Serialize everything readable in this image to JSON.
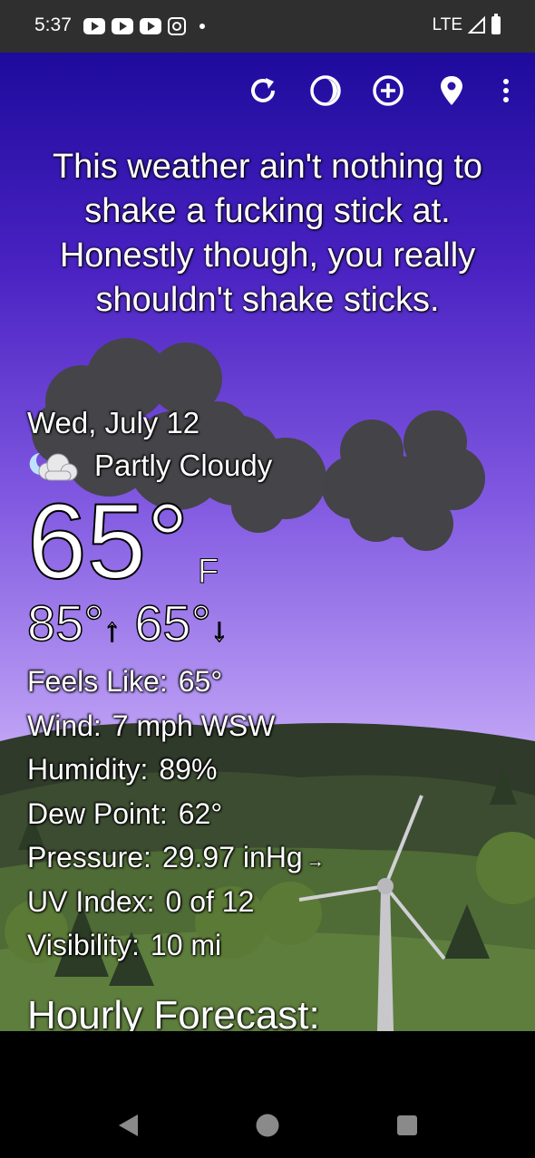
{
  "status_bar": {
    "time": "5:37",
    "network": "LTE",
    "icons": [
      "youtube-icon",
      "youtube-icon",
      "youtube-icon",
      "instagram-icon",
      "notification-dot",
      "signal-icon",
      "battery-icon"
    ]
  },
  "toolbar": {
    "icons": [
      "refresh-icon",
      "theme-icon",
      "add-location-icon",
      "location-pin-icon",
      "overflow-menu-icon"
    ]
  },
  "quote": {
    "text": "This weather ain't nothing to shake a fucking stick at. Honestly though, you really shouldn't shake sticks."
  },
  "current": {
    "date": "Wed, July 12",
    "condition": "Partly Cloudy",
    "condition_icon": "partly-cloudy-night-icon",
    "temperature": "65°",
    "unit": "F",
    "high": "85°",
    "low": "65°",
    "up_arrow": "↑",
    "down_arrow": "↓"
  },
  "details": [
    {
      "label": "Feels Like:",
      "value": "65°"
    },
    {
      "label": "Wind:",
      "value": "7 mph WSW"
    },
    {
      "label": "Humidity:",
      "value": "89%"
    },
    {
      "label": "Dew Point:",
      "value": "62°"
    },
    {
      "label": "Pressure:",
      "value": "29.97 inHg"
    },
    {
      "label": "UV Index:",
      "value": "0 of 12"
    },
    {
      "label": "Visibility:",
      "value": "10 mi"
    }
  ],
  "pressure_trend": "→",
  "hourly_heading": "Hourly Forecast:",
  "colors": {
    "sky_top": "#1d0b9c",
    "sky_bottom": "#c9b1f9",
    "cloud": "#444444",
    "hills": "#3f5a2c"
  },
  "navigation": {
    "icons": [
      "back-icon",
      "home-icon",
      "recents-icon"
    ]
  }
}
